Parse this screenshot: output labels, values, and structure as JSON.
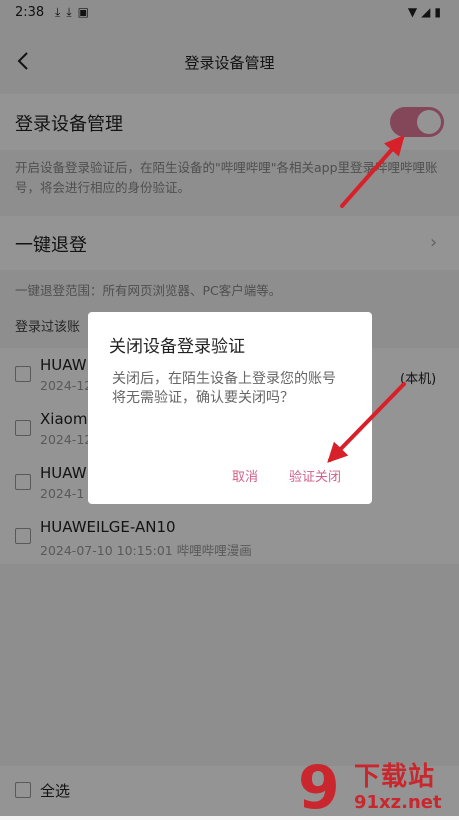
{
  "status_bar": {
    "time": "2:38",
    "left_icons": [
      "download-icon",
      "download-icon",
      "app-notification-icon"
    ],
    "right_icons": [
      "wifi-icon",
      "signal-icon",
      "battery-icon"
    ]
  },
  "nav": {
    "title": "登录设备管理"
  },
  "device_management": {
    "title": "登录设备管理",
    "toggle_on": true,
    "hint": "开启设备登录验证后，在陌生设备的\"哔哩哔哩\"各相关app里登录哔哩哔哩账号，将会进行相应的身份验证。"
  },
  "one_click_logout": {
    "title": "一键退登",
    "hint": "一键退登范围：所有网页浏览器、PC客户端等。"
  },
  "devices": {
    "section_label": "登录过该账",
    "items": [
      {
        "name": "HUAWE",
        "time": "2024-12",
        "tag": "(本机)"
      },
      {
        "name": "Xiaom",
        "time": "2024-12",
        "tag": ""
      },
      {
        "name": "HUAW",
        "time": "2024-1",
        "tag": ""
      },
      {
        "name": "HUAWEILGE-AN10",
        "time": "2024-07-10 10:15:01 哔哩哔哩漫画",
        "tag": ""
      }
    ]
  },
  "bottom_bar": {
    "select_all": "全选"
  },
  "dialog": {
    "title": "关闭设备登录验证",
    "message": "关闭后，在陌生设备上登录您的账号将无需验证，确认要关闭吗？",
    "cancel": "取消",
    "confirm": "验证关闭"
  },
  "watermark": {
    "logo": "9",
    "text_top": "下载站",
    "text_bottom": "91xz.net"
  },
  "colors": {
    "accent": "#d2628b",
    "toggle": "#e3799a",
    "arrow": "#d8202a",
    "watermark": "#c9272d"
  }
}
